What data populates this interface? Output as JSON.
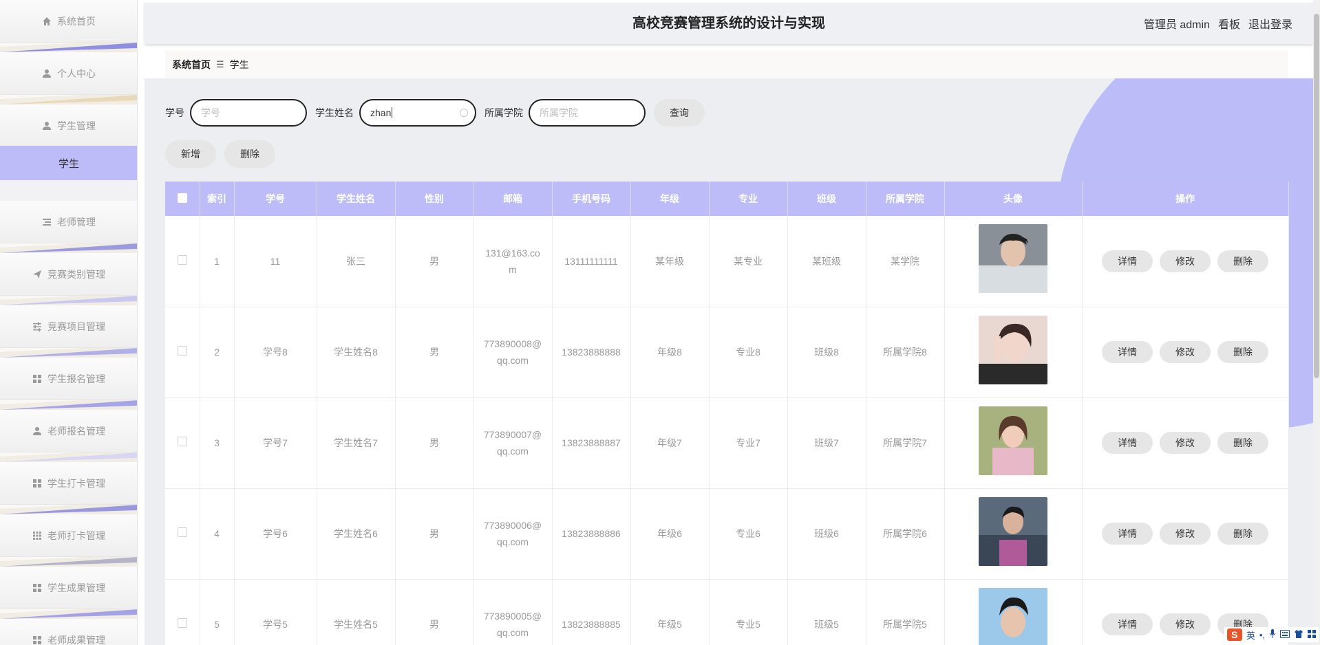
{
  "header": {
    "title": "高校竞赛管理系统的设计与实现",
    "user_label": "管理员 admin",
    "board_label": "看板",
    "logout_label": "退出登录"
  },
  "sidebar": {
    "items": [
      {
        "label": "系统首页",
        "icon": "home-icon"
      },
      {
        "label": "个人中心",
        "icon": "user-icon"
      },
      {
        "label": "学生管理",
        "icon": "user-icon"
      },
      {
        "label": "老师管理",
        "icon": "list-icon"
      },
      {
        "label": "竞赛类别管理",
        "icon": "send-icon"
      },
      {
        "label": "竞赛项目管理",
        "icon": "sliders-icon"
      },
      {
        "label": "学生报名管理",
        "icon": "grid-icon"
      },
      {
        "label": "老师报名管理",
        "icon": "user-icon"
      },
      {
        "label": "学生打卡管理",
        "icon": "grid-icon"
      },
      {
        "label": "老师打卡管理",
        "icon": "grid9-icon"
      },
      {
        "label": "学生成果管理",
        "icon": "grid-icon"
      },
      {
        "label": "老师成果管理",
        "icon": "grid-icon"
      }
    ],
    "active_sub": "学生",
    "accent": "#bdbcf8"
  },
  "breadcrumb": {
    "home": "系统首页",
    "separator": "☰",
    "current": "学生"
  },
  "search": {
    "student_no_label": "学号",
    "student_no_placeholder": "学号",
    "student_name_label": "学生姓名",
    "student_name_value": "zhan",
    "college_label": "所属学院",
    "college_placeholder": "所属学院",
    "query_button": "查询"
  },
  "actions": {
    "add_label": "新增",
    "delete_label": "删除"
  },
  "table": {
    "columns": [
      "索引",
      "学号",
      "学生姓名",
      "性别",
      "邮箱",
      "手机号码",
      "年级",
      "专业",
      "班级",
      "所属学院",
      "头像",
      "操作"
    ],
    "rows": [
      {
        "index": "1",
        "no": "11",
        "name": "张三",
        "gender": "男",
        "email_1": "131@163.co",
        "email_2": "m",
        "phone": "13111111111",
        "grade": "某年级",
        "major": "某专业",
        "class": "某班级",
        "college": "某学院",
        "avatar": "avatar-photo-1"
      },
      {
        "index": "2",
        "no": "学号8",
        "name": "学生姓名8",
        "gender": "男",
        "email_1": "773890008@",
        "email_2": "qq.com",
        "phone": "13823888888",
        "grade": "年级8",
        "major": "专业8",
        "class": "班级8",
        "college": "所属学院8",
        "avatar": "avatar-photo-2"
      },
      {
        "index": "3",
        "no": "学号7",
        "name": "学生姓名7",
        "gender": "男",
        "email_1": "773890007@",
        "email_2": "qq.com",
        "phone": "13823888887",
        "grade": "年级7",
        "major": "专业7",
        "class": "班级7",
        "college": "所属学院7",
        "avatar": "avatar-photo-3"
      },
      {
        "index": "4",
        "no": "学号6",
        "name": "学生姓名6",
        "gender": "男",
        "email_1": "773890006@",
        "email_2": "qq.com",
        "phone": "13823888886",
        "grade": "年级6",
        "major": "专业6",
        "class": "班级6",
        "college": "所属学院6",
        "avatar": "avatar-photo-4"
      },
      {
        "index": "5",
        "no": "学号5",
        "name": "学生姓名5",
        "gender": "男",
        "email_1": "773890005@",
        "email_2": "qq.com",
        "phone": "13823888885",
        "grade": "年级5",
        "major": "专业5",
        "class": "班级5",
        "college": "所属学院5",
        "avatar": "avatar-photo-5"
      }
    ],
    "op_detail": "详情",
    "op_edit": "修改",
    "op_delete": "删除"
  },
  "ime": {
    "logo": "S",
    "mode": "英"
  }
}
